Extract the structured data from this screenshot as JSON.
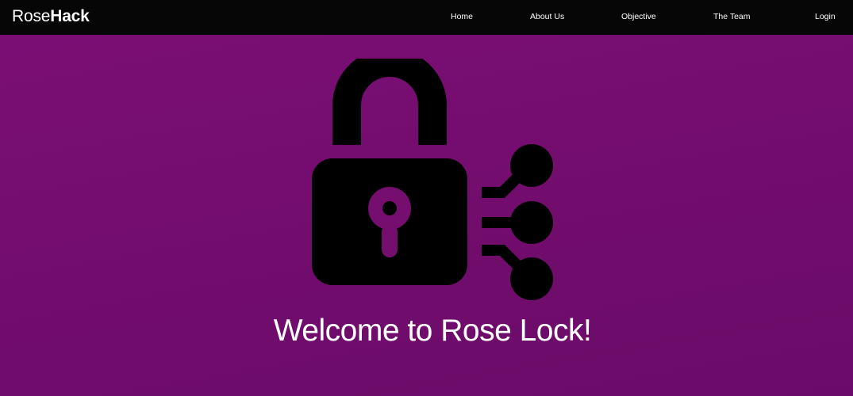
{
  "brand": {
    "light": "Rose",
    "bold": "Hack"
  },
  "nav": {
    "home": "Home",
    "about": "About Us",
    "objective": "Objective",
    "team": "The Team",
    "login": "Login"
  },
  "hero": {
    "icon": "digital-lock-icon",
    "heading": "Welcome to Rose Lock!"
  },
  "colors": {
    "navbar": "#060606",
    "background": "#760e70",
    "icon": "#000000",
    "text": "#ffffff"
  }
}
